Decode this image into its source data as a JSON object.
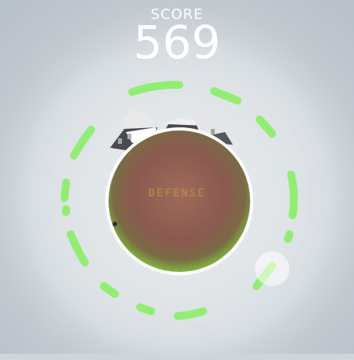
{
  "score": {
    "label": "SCORE",
    "value": "569"
  },
  "logo": {
    "subtitle": "",
    "title": "DEFENSE"
  },
  "colors": {
    "shield": "#8ef06b",
    "grass": "#7dbf3b",
    "planet": "#8d5b4f",
    "background": "#c8cfd5"
  },
  "icons": {
    "action": "fire-button",
    "planet": "planet-icon"
  }
}
